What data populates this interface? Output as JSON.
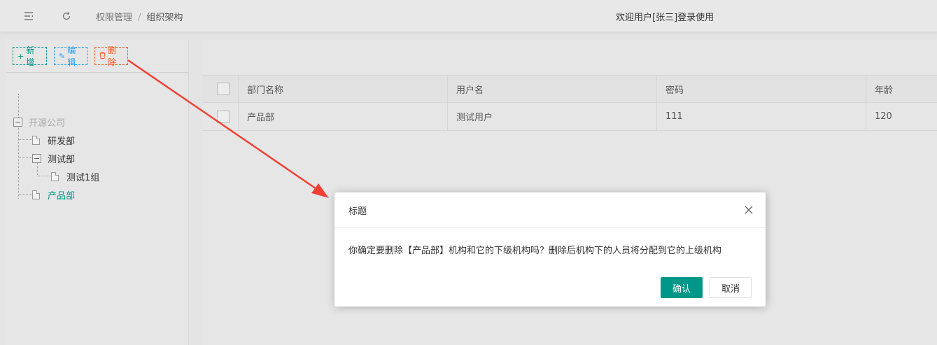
{
  "header": {
    "breadcrumb": [
      "权限管理",
      "组织架构"
    ],
    "breadcrumb_sep": "/",
    "welcome": "欢迎用户[张三]登录使用"
  },
  "toolbar": {
    "add_label": "新增",
    "edit_label": "编辑",
    "delete_label": "删除"
  },
  "tree": {
    "root": "开源公司",
    "nodes": [
      "研发部",
      "测试部",
      "测试1组",
      "产品部"
    ],
    "selected": "产品部"
  },
  "table": {
    "columns": [
      "部门名称",
      "用户名",
      "密码",
      "年龄"
    ],
    "rows": [
      [
        "产品部",
        "测试用户",
        "111",
        "120"
      ]
    ]
  },
  "dialog": {
    "title": "标题",
    "message": "你确定要删除【产品部】机构和它的下级机构吗？删除后机构下的人员将分配到它的上级机构",
    "confirm_label": "确认",
    "cancel_label": "取消"
  },
  "colors": {
    "primary": "#009688",
    "info": "#1e9fff",
    "danger": "#ff5722",
    "arrow": "#f04134"
  }
}
